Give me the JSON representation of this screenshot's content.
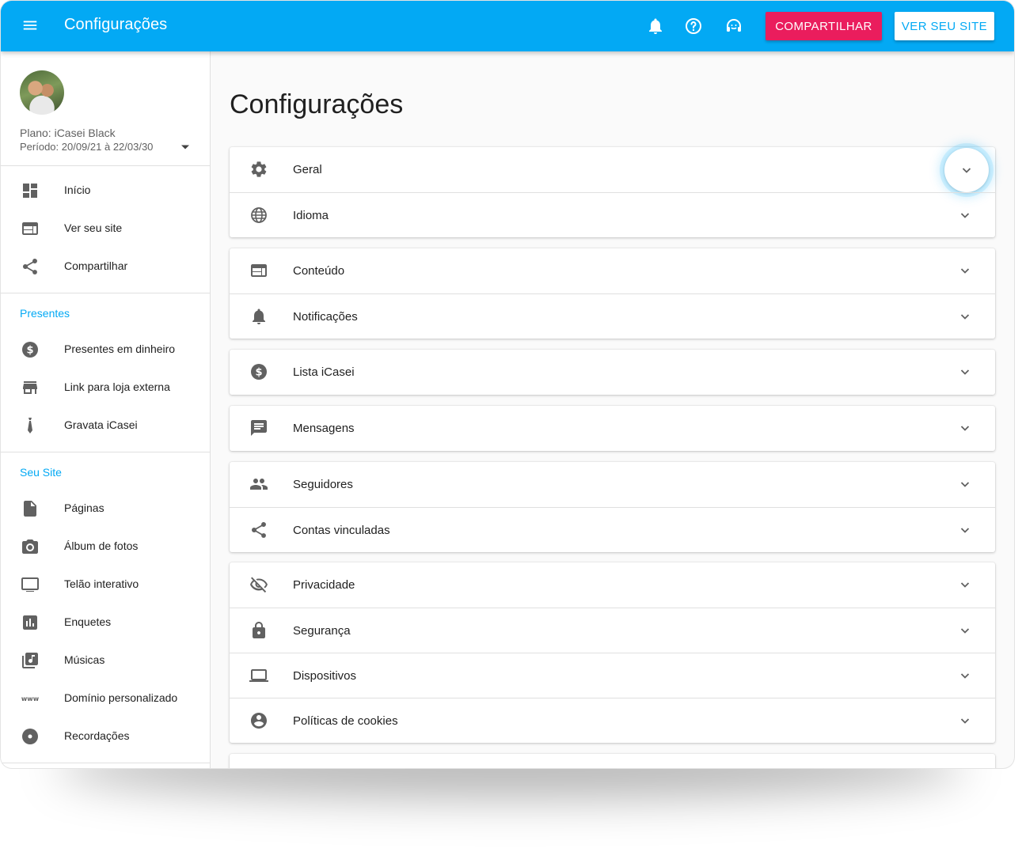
{
  "topbar": {
    "title": "Configurações",
    "share_label": "COMPARTILHAR",
    "site_label": "VER SEU SITE",
    "icons": [
      "menu-icon",
      "bell-icon",
      "help-icon",
      "support-icon"
    ]
  },
  "sidebar": {
    "plan": "Plano: iCasei Black",
    "period": "Período: 20/09/21 à 22/03/30",
    "main_items": [
      {
        "label": "Início",
        "icon": "dashboard-icon"
      },
      {
        "label": "Ver seu site",
        "icon": "web-icon"
      },
      {
        "label": "Compartilhar",
        "icon": "share-icon"
      }
    ],
    "gifts_title": "Presentes",
    "gifts_items": [
      {
        "label": "Presentes em dinheiro",
        "icon": "money-icon"
      },
      {
        "label": "Link para loja externa",
        "icon": "store-icon"
      },
      {
        "label": "Gravata iCasei",
        "icon": "tie-icon"
      }
    ],
    "site_title": "Seu Site",
    "site_items": [
      {
        "label": "Páginas",
        "icon": "page-icon"
      },
      {
        "label": "Álbum de fotos",
        "icon": "camera-icon"
      },
      {
        "label": "Telão interativo",
        "icon": "screen-icon"
      },
      {
        "label": "Enquetes",
        "icon": "poll-icon"
      },
      {
        "label": "Músicas",
        "icon": "music-icon"
      },
      {
        "label": "Domínio personalizado",
        "icon": "www-icon"
      },
      {
        "label": "Recordações",
        "icon": "disc-icon"
      }
    ]
  },
  "main": {
    "title": "Configurações",
    "cards": [
      [
        {
          "label": "Geral",
          "icon": "gear-icon"
        },
        {
          "label": "Idioma",
          "icon": "globe-icon"
        }
      ],
      [
        {
          "label": "Conteúdo",
          "icon": "web-icon"
        },
        {
          "label": "Notificações",
          "icon": "bell-icon"
        }
      ],
      [
        {
          "label": "Lista iCasei",
          "icon": "money-icon"
        }
      ],
      [
        {
          "label": "Mensagens",
          "icon": "message-icon"
        }
      ],
      [
        {
          "label": "Seguidores",
          "icon": "people-icon"
        },
        {
          "label": "Contas vinculadas",
          "icon": "share-icon"
        }
      ],
      [
        {
          "label": "Privacidade",
          "icon": "eye-off-icon"
        },
        {
          "label": "Segurança",
          "icon": "lock-icon"
        },
        {
          "label": "Dispositivos",
          "icon": "laptop-icon"
        },
        {
          "label": "Políticas de cookies",
          "icon": "account-icon"
        }
      ]
    ]
  },
  "colors": {
    "primary": "#03a9f4",
    "accent": "#ea1d5d",
    "icon": "#616161"
  }
}
